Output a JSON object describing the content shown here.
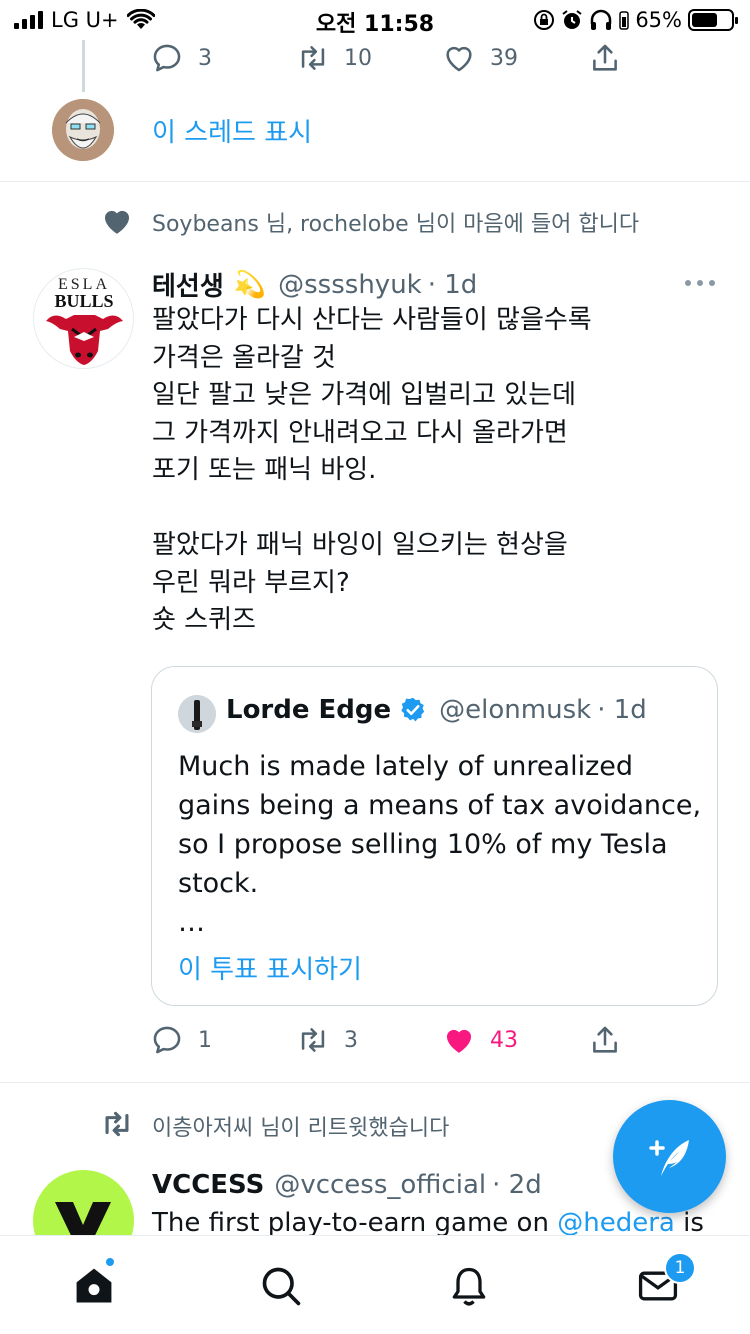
{
  "status_bar": {
    "carrier": "LG U+",
    "time": "오전 11:58",
    "battery": "65%",
    "battery_level": 0.65
  },
  "thread_top": {
    "reply_count": "3",
    "retweet_count": "10",
    "like_count": "39",
    "show_thread_label": "이 스레드 표시"
  },
  "tweet1": {
    "social_context": "Soybeans 님, rochelobe 님이 마음에 들어 합니다",
    "display_name": "테선생",
    "emoji": "💫",
    "handle": "@sssshyuk",
    "time": "· 1d",
    "text_lines": [
      "팔았다가 다시 산다는 사람들이 많을수록",
      "가격은 올라갈 것",
      "일단 팔고 낮은 가격에 입벌리고 있는데",
      "그 가격까지 안내려오고 다시 올라가면",
      "포기 또는 패닉 바잉.",
      "",
      "팔았다가 패닉 바잉이 일으키는 현상을",
      "우린 뭐라 부르지?",
      "숏 스퀴즈"
    ],
    "avatar_text": {
      "top": "ESLA",
      "bottom": "BULLS"
    },
    "quote": {
      "display_name": "Lorde Edge",
      "handle": "@elonmusk",
      "time": "· 1d",
      "text_lines": [
        "Much is made lately of unrealized",
        "gains being a means of tax avoidance,",
        "so I propose selling 10% of my Tesla",
        "stock.",
        "…"
      ],
      "show_poll_label": "이 투표 표시하기"
    },
    "reply_count": "1",
    "retweet_count": "3",
    "like_count": "43"
  },
  "tweet2": {
    "social_context": "이층아저씨 님이 리트윗했습니다",
    "display_name": "VCCESS",
    "handle": "@vccess_official",
    "time": "· 2d",
    "text_prefix": "The first play-to-earn game on ",
    "mention": "@hedera",
    "text_suffix": " is"
  },
  "tabbar": {
    "messages_badge": "1"
  },
  "colors": {
    "accent": "#1d9bf0",
    "like_active": "#f91880",
    "muted": "#536471"
  }
}
